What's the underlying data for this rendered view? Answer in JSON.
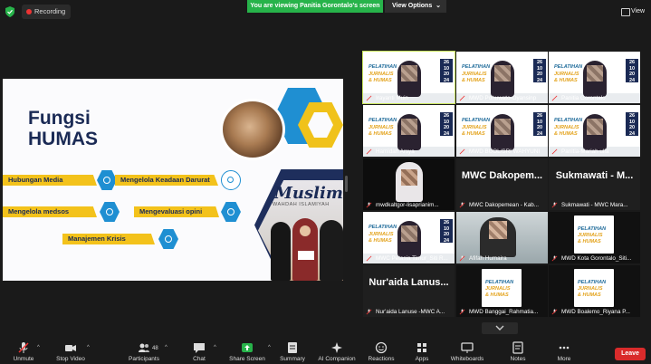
{
  "top": {
    "recording_label": "Recording",
    "viewing_banner": "You are viewing Panitia Gorontalo's screen",
    "view_options": "View Options",
    "view_label": "View"
  },
  "slide": {
    "title_line1": "Fungsi",
    "title_line2": "HUMAS",
    "items": [
      "Hubungan Media",
      "Mengelola Keadaan Darurat",
      "Mengelola medsos",
      "Mengevaluasi opini",
      "Manajemen Krisis"
    ],
    "logo_text": "Muslimah",
    "logo_sub": "WAHDAH ISLAMIYAH"
  },
  "poster": {
    "line1": "PELATIHAN",
    "line2": "JURNALIS",
    "line3": "& HUMAS",
    "date": [
      "26",
      "10",
      "20",
      "24"
    ]
  },
  "gallery": [
    {
      "name": "Irayanti Muin",
      "kind": "poster-person",
      "active": true
    },
    {
      "name": "MWD Pohuwato-Oyansinp",
      "kind": "poster-person"
    },
    {
      "name": "Panitia Gorontalo",
      "kind": "poster-person"
    },
    {
      "name": "Hamidah Arsya",
      "kind": "poster-person"
    },
    {
      "name": "MWD BUOL/SRI WAHYUNI",
      "kind": "poster-person"
    },
    {
      "name": "Panitia-Mariah ulfa",
      "kind": "poster-person"
    },
    {
      "name": "mwdkaltgor-lisaprianim...",
      "kind": "dark-person"
    },
    {
      "name": "MWC Dakopemean - Kab...",
      "kind": "text",
      "big": "MWC Dakopem..."
    },
    {
      "name": "Sukmawati - MWC Mara...",
      "kind": "text",
      "big": "Sukmawati - M..."
    },
    {
      "name": "MWC Petasia Timur_Siti R...",
      "kind": "poster-person"
    },
    {
      "name": "Afifah Humaira",
      "kind": "room-person"
    },
    {
      "name": "MWD Kota Gorontalo_Siti...",
      "kind": "poster-small"
    },
    {
      "name": "Nur'aida Lanuse -MWC A...",
      "kind": "text",
      "big": "Nur'aida Lanus..."
    },
    {
      "name": "MWD Banggai_Rahmatia...",
      "kind": "poster-small"
    },
    {
      "name": "MWD Boalemo_Riyana P...",
      "kind": "poster-small"
    }
  ],
  "toolbar": {
    "unmute": "Unmute",
    "stop_video": "Stop Video",
    "participants": "Participants",
    "participants_count": "48",
    "chat": "Chat",
    "share_screen": "Share Screen",
    "summary": "Summary",
    "ai_companion": "AI Companion",
    "reactions": "Reactions",
    "apps": "Apps",
    "whiteboards": "Whiteboards",
    "notes": "Notes",
    "more": "More",
    "leave": "Leave"
  },
  "colors": {
    "accent_green": "#27b34a",
    "leave_red": "#d92b2b",
    "active_speaker": "#c8e35b",
    "slide_navy": "#1a2a55",
    "slide_yellow": "#f3c21b",
    "slide_blue": "#1f8fd2"
  }
}
